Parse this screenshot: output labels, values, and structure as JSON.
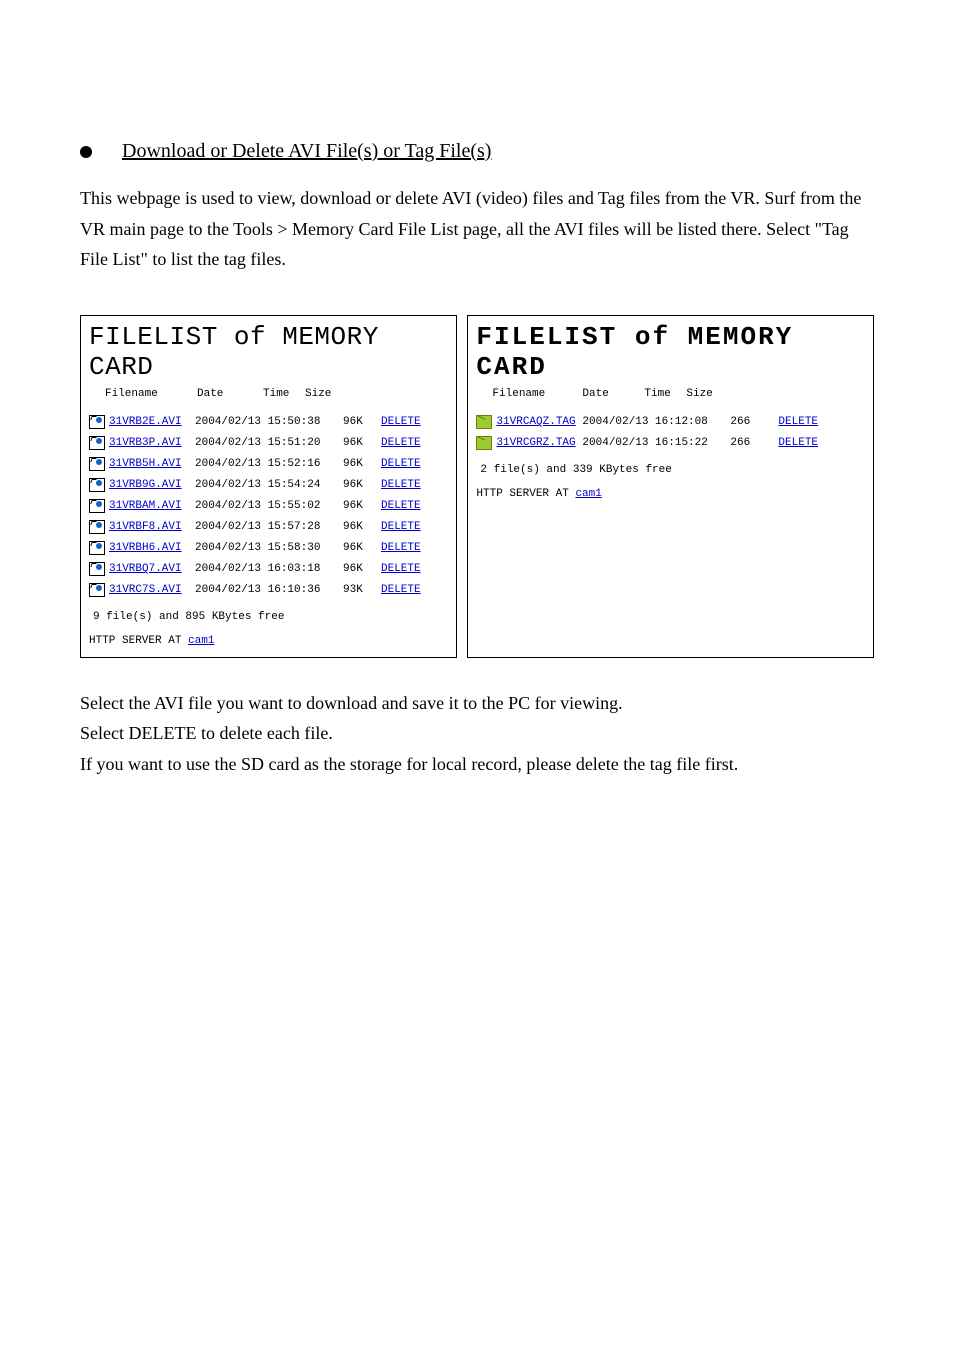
{
  "bullet_heading": "Download or Delete AVI File(s) or Tag File(s)",
  "intro": "This webpage is used to view, download or delete AVI (video) files and Tag files from the VR. Surf from the VR main page to the Tools > Memory Card File List page, all the AVI files will be listed there. Select \"Tag File List\" to list the tag files.",
  "labels": {
    "filename": "Filename",
    "date": "Date",
    "time": "Time",
    "size": "Size",
    "delete": "DELETE",
    "server_prefix": "HTTP SERVER AT ",
    "server_link": "cam1"
  },
  "panel_left": {
    "title": "FILELIST of MEMORY CARD",
    "rows": [
      {
        "icon": "video-icon",
        "fn": "31VRB2E.AVI",
        "dt": "2004/02/13 15:50:38",
        "sz": "96K"
      },
      {
        "icon": "video-icon",
        "fn": "31VRB3P.AVI",
        "dt": "2004/02/13 15:51:20",
        "sz": "96K"
      },
      {
        "icon": "video-icon",
        "fn": "31VRB5H.AVI",
        "dt": "2004/02/13 15:52:16",
        "sz": "96K"
      },
      {
        "icon": "video-icon",
        "fn": "31VRB9G.AVI",
        "dt": "2004/02/13 15:54:24",
        "sz": "96K"
      },
      {
        "icon": "video-icon",
        "fn": "31VRBAM.AVI",
        "dt": "2004/02/13 15:55:02",
        "sz": "96K"
      },
      {
        "icon": "video-icon",
        "fn": "31VRBF8.AVI",
        "dt": "2004/02/13 15:57:28",
        "sz": "96K"
      },
      {
        "icon": "video-icon",
        "fn": "31VRBH6.AVI",
        "dt": "2004/02/13 15:58:30",
        "sz": "96K"
      },
      {
        "icon": "video-icon",
        "fn": "31VRBQ7.AVI",
        "dt": "2004/02/13 16:03:18",
        "sz": "96K"
      },
      {
        "icon": "video-icon",
        "fn": "31VRC7S.AVI",
        "dt": "2004/02/13 16:10:36",
        "sz": "93K"
      }
    ],
    "summary": "9 file(s) and 895 KBytes free"
  },
  "panel_right": {
    "title": "FILELIST of MEMORY CARD",
    "rows": [
      {
        "icon": "tag-icon",
        "fn": "31VRCAQZ.TAG",
        "dt": "2004/02/13 16:12:08",
        "sz": "266"
      },
      {
        "icon": "tag-icon",
        "fn": "31VRCGRZ.TAG",
        "dt": "2004/02/13 16:15:22",
        "sz": "266"
      }
    ],
    "summary": "2 file(s) and 339 KBytes free"
  },
  "outro": "Select the AVI file you want to download and save it to the PC for viewing.\nSelect DELETE to delete each file.\nIf you want to use the SD card as the storage for local record, please delete the tag file first."
}
